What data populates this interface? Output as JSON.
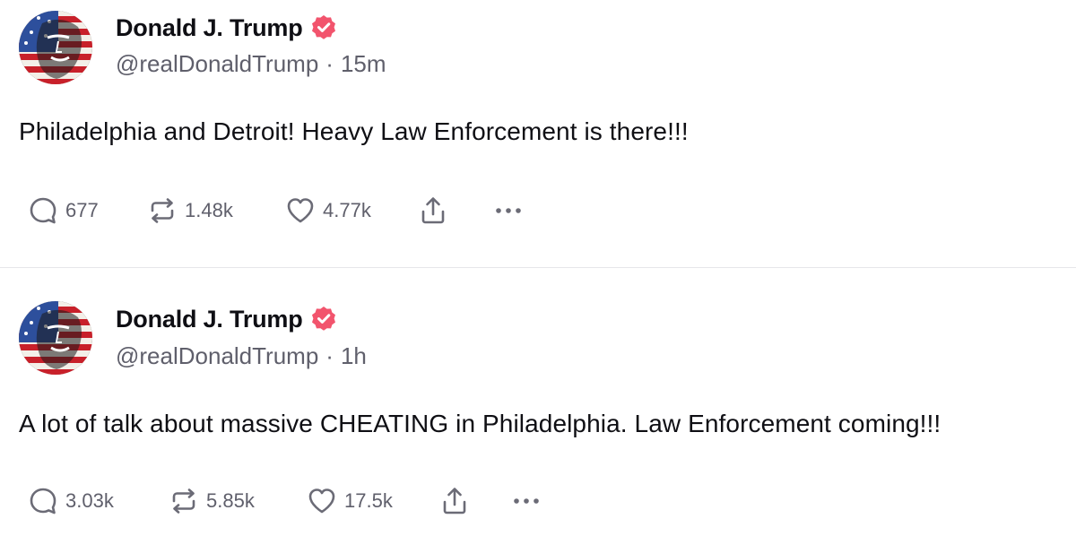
{
  "colors": {
    "verified_badge": "#f2546d",
    "text_primary": "#0f0f14",
    "text_secondary": "#5f5f6b",
    "divider": "#e6e6ea"
  },
  "posts": [
    {
      "author": {
        "display_name": "Donald J. Trump",
        "handle": "@realDonaldTrump",
        "verified": true,
        "avatar_icon": "avatar-portrait-flag"
      },
      "separator": "·",
      "time": "15m",
      "text": "Philadelphia and Detroit! Heavy Law Enforcement is there!!!",
      "actions": {
        "replies": "677",
        "reposts": "1.48k",
        "likes": "4.77k",
        "share_icon": "share-icon",
        "more_icon": "more-icon"
      }
    },
    {
      "author": {
        "display_name": "Donald J. Trump",
        "handle": "@realDonaldTrump",
        "verified": true,
        "avatar_icon": "avatar-portrait-flag"
      },
      "separator": "·",
      "time": "1h",
      "text": "A lot of talk about massive CHEATING in Philadelphia. Law Enforcement coming!!!",
      "actions": {
        "replies": "3.03k",
        "reposts": "5.85k",
        "likes": "17.5k",
        "share_icon": "share-icon",
        "more_icon": "more-icon"
      }
    }
  ]
}
